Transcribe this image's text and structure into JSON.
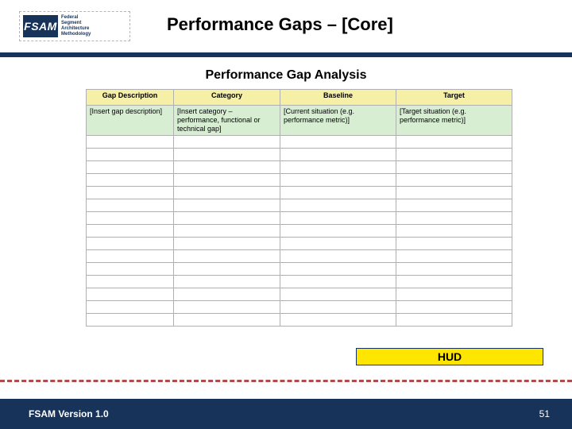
{
  "logo": {
    "abbr": "FSAM",
    "line1": "Federal",
    "line2": "Segment",
    "line3": "Architecture",
    "line4": "Methodology"
  },
  "title": "Performance Gaps – [Core]",
  "subtitle": "Performance Gap Analysis",
  "table": {
    "headers": [
      "Gap Description",
      "Category",
      "Baseline",
      "Target"
    ],
    "instruction_row": [
      "[Insert gap description]",
      "[Insert category – performance, functional or technical gap]",
      "[Current situation (e.g. performance metric)]",
      "[Target situation (e.g. performance metric)]"
    ],
    "empty_rows": 15
  },
  "hud_label": "HUD",
  "footer": {
    "version": "FSAM Version 1.0",
    "page": "51"
  }
}
